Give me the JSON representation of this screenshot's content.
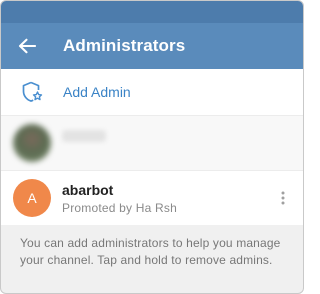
{
  "appbar": {
    "title": "Administrators",
    "back_icon": "arrow-left-icon"
  },
  "add_admin": {
    "label": "Add Admin",
    "icon": "shield-star-icon",
    "accent": "#3a83c6"
  },
  "admins": [
    {
      "avatar": "blurred-photo"
    },
    {
      "name": "abarbot",
      "subtitle": "Promoted by Ha Rsh",
      "avatar_letter": "A",
      "avatar_color": "#f0884a",
      "menu_icon": "more-vertical-icon"
    }
  ],
  "info_text": "You can add administrators to help you manage your channel. Tap and hold to remove admins.",
  "colors": {
    "appbar": "#5a8bbb",
    "statusbar": "#4d7cac"
  }
}
